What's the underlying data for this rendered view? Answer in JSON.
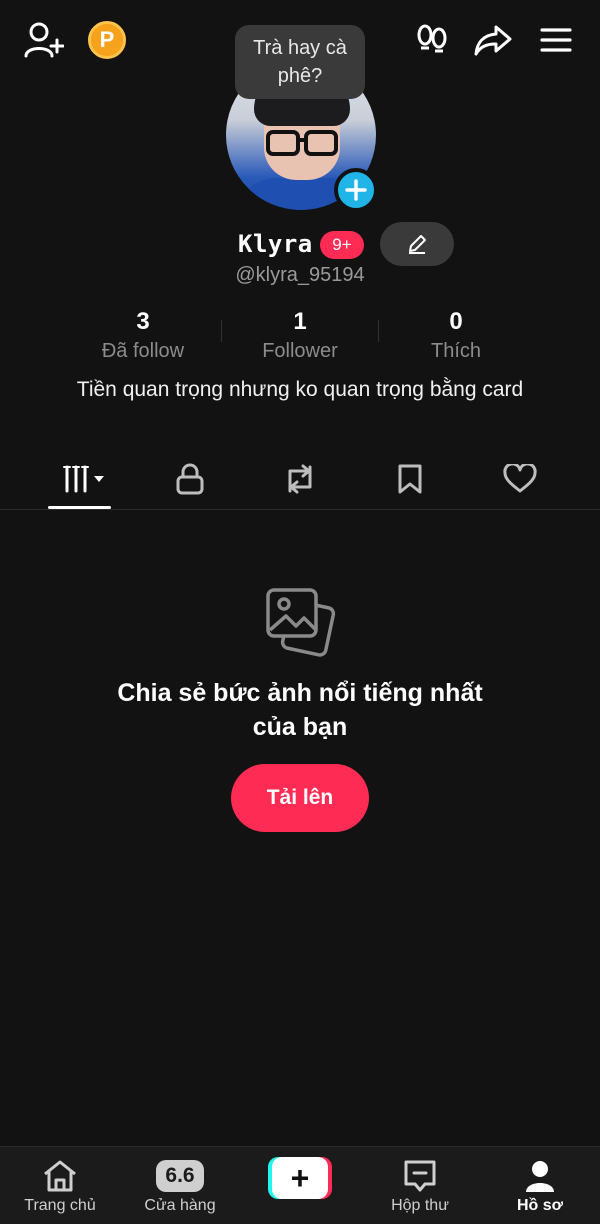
{
  "header": {
    "coin_letter": "P",
    "note_text": "Trà hay cà phê?"
  },
  "profile": {
    "display_name": "Klyra",
    "notification_badge": "9+",
    "username": "@klyra_95194",
    "bio": "Tiền quan trọng nhưng ko quan trọng bằng card"
  },
  "stats": [
    {
      "value": "3",
      "label": "Đã follow"
    },
    {
      "value": "1",
      "label": "Follower"
    },
    {
      "value": "0",
      "label": "Thích"
    }
  ],
  "tabs": {
    "icons": [
      "grid-icon",
      "lock-icon",
      "repost-icon",
      "bookmark-icon",
      "heart-icon"
    ],
    "active_index": 0
  },
  "empty_state": {
    "title": "Chia sẻ bức ảnh nổi tiếng nhất của bạn",
    "button_label": "Tải lên"
  },
  "bottom_nav": {
    "home": "Trang chủ",
    "shop": "Cửa hàng",
    "shop_badge": "6.6",
    "create": "+",
    "inbox": "Hộp thư",
    "profile": "Hồ sơ"
  },
  "colors": {
    "background": "#121212",
    "accent": "#fe2c55",
    "avatar_add": "#20b5e6",
    "coin": "#f6a21d"
  }
}
